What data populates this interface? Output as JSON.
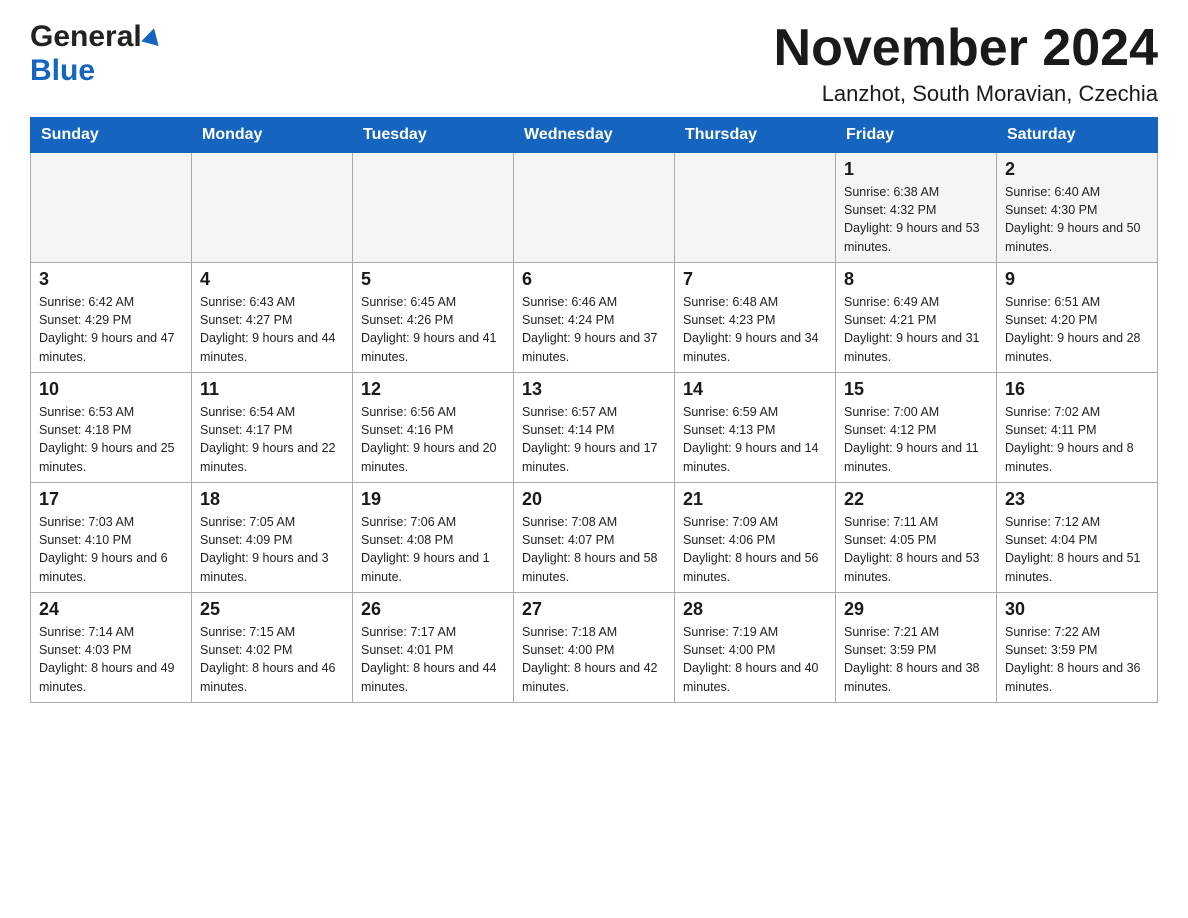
{
  "header": {
    "logo_general": "General",
    "logo_blue": "Blue",
    "month_title": "November 2024",
    "location": "Lanzhot, South Moravian, Czechia"
  },
  "calendar": {
    "weekdays": [
      "Sunday",
      "Monday",
      "Tuesday",
      "Wednesday",
      "Thursday",
      "Friday",
      "Saturday"
    ],
    "weeks": [
      [
        {
          "day": "",
          "info": ""
        },
        {
          "day": "",
          "info": ""
        },
        {
          "day": "",
          "info": ""
        },
        {
          "day": "",
          "info": ""
        },
        {
          "day": "",
          "info": ""
        },
        {
          "day": "1",
          "info": "Sunrise: 6:38 AM\nSunset: 4:32 PM\nDaylight: 9 hours and 53 minutes."
        },
        {
          "day": "2",
          "info": "Sunrise: 6:40 AM\nSunset: 4:30 PM\nDaylight: 9 hours and 50 minutes."
        }
      ],
      [
        {
          "day": "3",
          "info": "Sunrise: 6:42 AM\nSunset: 4:29 PM\nDaylight: 9 hours and 47 minutes."
        },
        {
          "day": "4",
          "info": "Sunrise: 6:43 AM\nSunset: 4:27 PM\nDaylight: 9 hours and 44 minutes."
        },
        {
          "day": "5",
          "info": "Sunrise: 6:45 AM\nSunset: 4:26 PM\nDaylight: 9 hours and 41 minutes."
        },
        {
          "day": "6",
          "info": "Sunrise: 6:46 AM\nSunset: 4:24 PM\nDaylight: 9 hours and 37 minutes."
        },
        {
          "day": "7",
          "info": "Sunrise: 6:48 AM\nSunset: 4:23 PM\nDaylight: 9 hours and 34 minutes."
        },
        {
          "day": "8",
          "info": "Sunrise: 6:49 AM\nSunset: 4:21 PM\nDaylight: 9 hours and 31 minutes."
        },
        {
          "day": "9",
          "info": "Sunrise: 6:51 AM\nSunset: 4:20 PM\nDaylight: 9 hours and 28 minutes."
        }
      ],
      [
        {
          "day": "10",
          "info": "Sunrise: 6:53 AM\nSunset: 4:18 PM\nDaylight: 9 hours and 25 minutes."
        },
        {
          "day": "11",
          "info": "Sunrise: 6:54 AM\nSunset: 4:17 PM\nDaylight: 9 hours and 22 minutes."
        },
        {
          "day": "12",
          "info": "Sunrise: 6:56 AM\nSunset: 4:16 PM\nDaylight: 9 hours and 20 minutes."
        },
        {
          "day": "13",
          "info": "Sunrise: 6:57 AM\nSunset: 4:14 PM\nDaylight: 9 hours and 17 minutes."
        },
        {
          "day": "14",
          "info": "Sunrise: 6:59 AM\nSunset: 4:13 PM\nDaylight: 9 hours and 14 minutes."
        },
        {
          "day": "15",
          "info": "Sunrise: 7:00 AM\nSunset: 4:12 PM\nDaylight: 9 hours and 11 minutes."
        },
        {
          "day": "16",
          "info": "Sunrise: 7:02 AM\nSunset: 4:11 PM\nDaylight: 9 hours and 8 minutes."
        }
      ],
      [
        {
          "day": "17",
          "info": "Sunrise: 7:03 AM\nSunset: 4:10 PM\nDaylight: 9 hours and 6 minutes."
        },
        {
          "day": "18",
          "info": "Sunrise: 7:05 AM\nSunset: 4:09 PM\nDaylight: 9 hours and 3 minutes."
        },
        {
          "day": "19",
          "info": "Sunrise: 7:06 AM\nSunset: 4:08 PM\nDaylight: 9 hours and 1 minute."
        },
        {
          "day": "20",
          "info": "Sunrise: 7:08 AM\nSunset: 4:07 PM\nDaylight: 8 hours and 58 minutes."
        },
        {
          "day": "21",
          "info": "Sunrise: 7:09 AM\nSunset: 4:06 PM\nDaylight: 8 hours and 56 minutes."
        },
        {
          "day": "22",
          "info": "Sunrise: 7:11 AM\nSunset: 4:05 PM\nDaylight: 8 hours and 53 minutes."
        },
        {
          "day": "23",
          "info": "Sunrise: 7:12 AM\nSunset: 4:04 PM\nDaylight: 8 hours and 51 minutes."
        }
      ],
      [
        {
          "day": "24",
          "info": "Sunrise: 7:14 AM\nSunset: 4:03 PM\nDaylight: 8 hours and 49 minutes."
        },
        {
          "day": "25",
          "info": "Sunrise: 7:15 AM\nSunset: 4:02 PM\nDaylight: 8 hours and 46 minutes."
        },
        {
          "day": "26",
          "info": "Sunrise: 7:17 AM\nSunset: 4:01 PM\nDaylight: 8 hours and 44 minutes."
        },
        {
          "day": "27",
          "info": "Sunrise: 7:18 AM\nSunset: 4:00 PM\nDaylight: 8 hours and 42 minutes."
        },
        {
          "day": "28",
          "info": "Sunrise: 7:19 AM\nSunset: 4:00 PM\nDaylight: 8 hours and 40 minutes."
        },
        {
          "day": "29",
          "info": "Sunrise: 7:21 AM\nSunset: 3:59 PM\nDaylight: 8 hours and 38 minutes."
        },
        {
          "day": "30",
          "info": "Sunrise: 7:22 AM\nSunset: 3:59 PM\nDaylight: 8 hours and 36 minutes."
        }
      ]
    ]
  }
}
